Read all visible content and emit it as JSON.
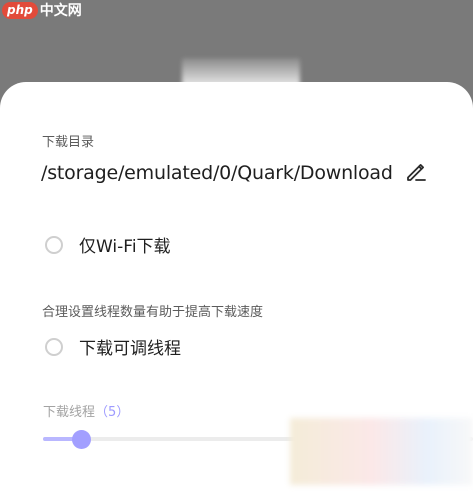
{
  "watermark": {
    "php": "php",
    "cn": "中文网"
  },
  "download_dir": {
    "label": "下载目录",
    "path": "/storage/emulated/0/Quark/Download"
  },
  "wifi_only": {
    "label": "仅Wi-Fi下载",
    "checked": false
  },
  "threads_hint": "合理设置线程数量有助于提高下载速度",
  "adjustable_threads": {
    "label": "下载可调线程",
    "checked": false
  },
  "thread_slider": {
    "label": "下载线程",
    "open": "（",
    "value": "5",
    "close": "）",
    "fraction": 0.09
  },
  "colors": {
    "accent": "#a29fff",
    "overlay": "#7a7a7a"
  },
  "icons": {
    "edit": "pencil-icon"
  }
}
